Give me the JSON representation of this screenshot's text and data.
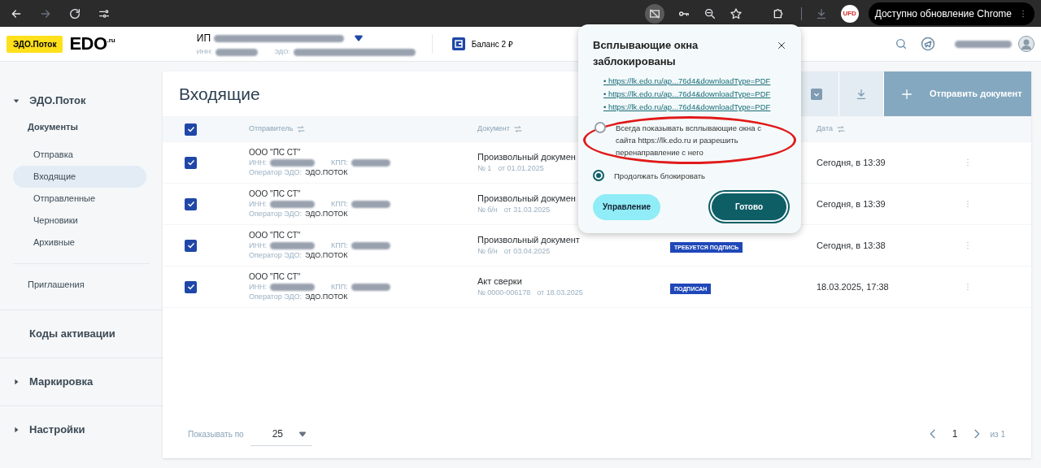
{
  "browser": {
    "update_label": "Доступно обновление Chrome",
    "profile_label": "UFD"
  },
  "header": {
    "brand_badge": "ЭДО.Поток",
    "logo": "EDO",
    "logo_suffix": ".ru",
    "org_prefix": "ИП",
    "inn_label": "ИНН:",
    "edo_label": "ЭДО:",
    "balance": "Баланс 2 ₽"
  },
  "sidebar": {
    "sections": [
      {
        "label": "ЭДО.Поток",
        "expanded": true,
        "children": [
          {
            "label": "Документы",
            "kind": "heading",
            "children": [
              {
                "label": "Отправка",
                "selected": false
              },
              {
                "label": "Входящие",
                "selected": true
              },
              {
                "label": "Отправленные",
                "selected": false
              },
              {
                "label": "Черновики",
                "selected": false
              },
              {
                "label": "Архивные",
                "selected": false
              }
            ]
          },
          {
            "label": "Приглашения",
            "kind": "link"
          }
        ]
      },
      {
        "label": "Коды активации"
      },
      {
        "label": "Маркировка",
        "expanded": false
      },
      {
        "label": "Настройки",
        "expanded": false
      }
    ]
  },
  "page": {
    "title": "Входящие",
    "send_button": "Отправить документ"
  },
  "table": {
    "all_checked": true,
    "columns": [
      {
        "label": "Отправитель"
      },
      {
        "label": "Документ"
      },
      {
        "label": "Дата"
      }
    ],
    "rows": [
      {
        "checked": true,
        "sender": "ООО \"ПС СТ\"",
        "inn_label": "ИНН:",
        "kpp_label": "КПП:",
        "operator_label": "Оператор ЭДО:",
        "operator": "ЭДО.ПОТОК",
        "document": "Произвольный докумен",
        "number": "№ 1",
        "doc_date": "от 01.01.2025",
        "date": "Сегодня, в 13:39"
      },
      {
        "checked": true,
        "sender": "ООО \"ПС СТ\"",
        "inn_label": "ИНН:",
        "kpp_label": "КПП:",
        "operator_label": "Оператор ЭДО:",
        "operator": "ЭДО.ПОТОК",
        "document": "Произвольный докумен",
        "number": "№ б/н",
        "doc_date": "от 31.03.2025",
        "date": "Сегодня, в 13:39"
      },
      {
        "checked": true,
        "sender": "ООО \"ПС СТ\"",
        "inn_label": "ИНН:",
        "kpp_label": "КПП:",
        "operator_label": "Оператор ЭДО:",
        "operator": "ЭДО.ПОТОК",
        "document": "Произвольный документ",
        "number": "№ б/н",
        "doc_date": "от 03.04.2025",
        "status": "ТРЕБУЕТСЯ ПОДПИСЬ",
        "date": "Сегодня, в 13:38"
      },
      {
        "checked": true,
        "sender": "ООО \"ПС СТ\"",
        "inn_label": "ИНН:",
        "kpp_label": "КПП:",
        "operator_label": "Оператор ЭДО:",
        "operator": "ЭДО.ПОТОК",
        "document": "Акт сверки",
        "number": "№ 0000-006178",
        "doc_date": "от 18.03.2025",
        "status": "ПОДПИСАН",
        "date": "18.03.2025, 17:38"
      }
    ]
  },
  "pagination": {
    "per_page_label": "Показывать по",
    "per_page": "25",
    "page": "1",
    "total": "из 1"
  },
  "popup": {
    "title": "Всплывающие окна заблокированы",
    "links": [
      "• https://lk.edo.ru/ap...76d4&downloadType=PDF",
      "• https://lk.edo.ru/ap...76d4&downloadType=PDF",
      "• https://lk.edo.ru/ap...76d4&downloadType=PDF"
    ],
    "options": [
      {
        "label": "Всегда показывать всплывающие окна с сайта https://lk.edo.ru и разрешить перенаправление с него",
        "selected": false,
        "circled": true
      },
      {
        "label": "Продолжать блокировать",
        "selected": true,
        "circled": false
      }
    ],
    "manage_button": "Управление",
    "done_button": "Готово"
  }
}
